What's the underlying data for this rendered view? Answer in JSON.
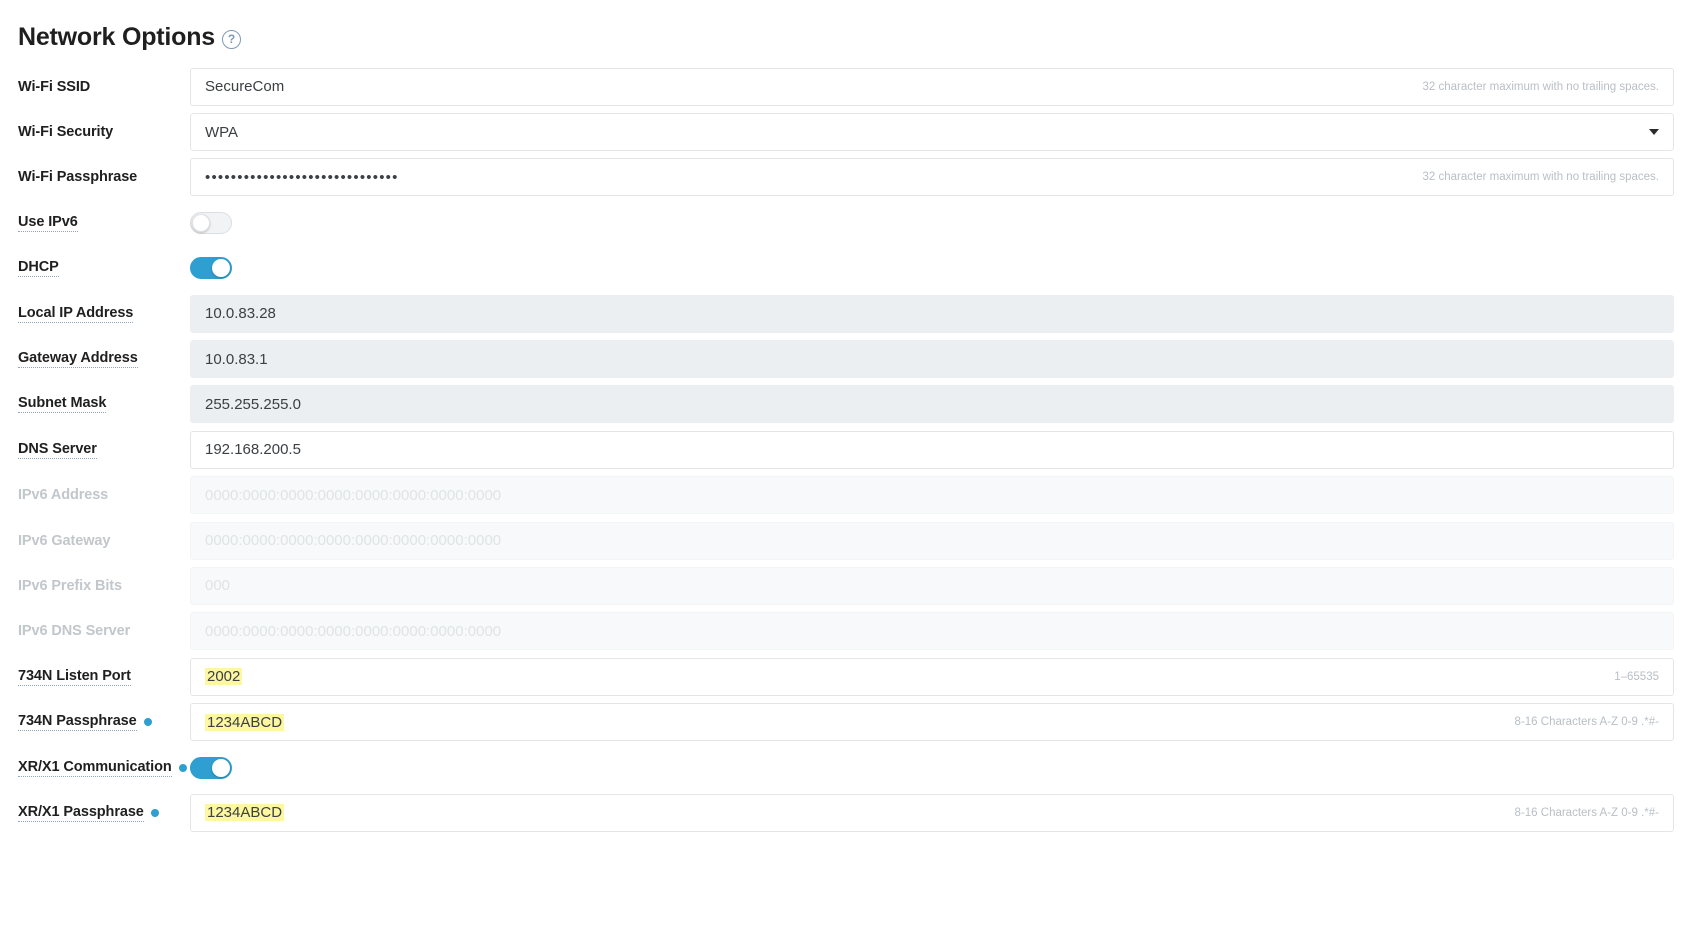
{
  "header": {
    "title": "Network Options",
    "help_icon": "help-circle-icon",
    "help_glyph": "?"
  },
  "hints": {
    "wifi_chars": "32 character maximum with no trailing spaces.",
    "port_range": "1–65535",
    "passphrase_rule": "8-16 Characters A-Z 0-9 .*#-"
  },
  "colors": {
    "toggle_on": "#2e9fd0",
    "dot": "#2e9fd0",
    "highlight": "#fcf7a0",
    "readonly_bg": "#eceff1"
  },
  "rows": [
    {
      "label": "Wi-Fi SSID",
      "type": "text",
      "value": "SecureCom",
      "hint": "32 character maximum with no trailing spaces.",
      "tooltip": false,
      "dot": false,
      "disabled": false,
      "readonly": false,
      "highlight": false
    },
    {
      "label": "Wi-Fi Security",
      "type": "select",
      "value": "WPA",
      "hint": "",
      "options": [
        "WPA"
      ],
      "tooltip": false,
      "dot": false,
      "disabled": false,
      "readonly": false,
      "highlight": false
    },
    {
      "label": "Wi-Fi Passphrase",
      "type": "password",
      "value": "••••••••••••••••••••••••••••••",
      "hint": "32 character maximum with no trailing spaces.",
      "tooltip": false,
      "dot": false,
      "disabled": false,
      "readonly": false,
      "highlight": false
    },
    {
      "label": "Use IPv6",
      "type": "toggle",
      "value": "off",
      "hint": "",
      "tooltip": true,
      "dot": false,
      "disabled": false,
      "readonly": false,
      "highlight": false
    },
    {
      "label": "DHCP",
      "type": "toggle",
      "value": "on",
      "hint": "",
      "tooltip": true,
      "dot": false,
      "disabled": false,
      "readonly": false,
      "highlight": false
    },
    {
      "label": "Local IP Address",
      "type": "text",
      "value": "10.0.83.28",
      "hint": "",
      "tooltip": true,
      "dot": false,
      "disabled": false,
      "readonly": true,
      "highlight": false
    },
    {
      "label": "Gateway Address",
      "type": "text",
      "value": "10.0.83.1",
      "hint": "",
      "tooltip": true,
      "dot": false,
      "disabled": false,
      "readonly": true,
      "highlight": false
    },
    {
      "label": "Subnet Mask",
      "type": "text",
      "value": "255.255.255.0",
      "hint": "",
      "tooltip": true,
      "dot": false,
      "disabled": false,
      "readonly": true,
      "highlight": false
    },
    {
      "label": "DNS Server",
      "type": "text",
      "value": "192.168.200.5",
      "hint": "",
      "tooltip": true,
      "dot": false,
      "disabled": false,
      "readonly": false,
      "highlight": false
    },
    {
      "label": "IPv6 Address",
      "type": "text",
      "value": "",
      "placeholder": "0000:0000:0000:0000:0000:0000:0000:0000",
      "hint": "",
      "tooltip": false,
      "dot": false,
      "disabled": true,
      "readonly": false,
      "highlight": false
    },
    {
      "label": "IPv6 Gateway",
      "type": "text",
      "value": "",
      "placeholder": "0000:0000:0000:0000:0000:0000:0000:0000",
      "hint": "",
      "tooltip": false,
      "dot": false,
      "disabled": true,
      "readonly": false,
      "highlight": false
    },
    {
      "label": "IPv6 Prefix Bits",
      "type": "text",
      "value": "",
      "placeholder": "000",
      "hint": "",
      "tooltip": false,
      "dot": false,
      "disabled": true,
      "readonly": false,
      "highlight": false
    },
    {
      "label": "IPv6 DNS Server",
      "type": "text",
      "value": "",
      "placeholder": "0000:0000:0000:0000:0000:0000:0000:0000",
      "hint": "",
      "tooltip": false,
      "dot": false,
      "disabled": true,
      "readonly": false,
      "highlight": false
    },
    {
      "label": "734N Listen Port",
      "type": "text",
      "value": "2002",
      "hint": "1–65535",
      "tooltip": true,
      "dot": false,
      "disabled": false,
      "readonly": false,
      "highlight": true
    },
    {
      "label": "734N Passphrase",
      "type": "text",
      "value": "1234ABCD",
      "hint": "8-16 Characters A-Z 0-9 .*#-",
      "tooltip": true,
      "dot": true,
      "disabled": false,
      "readonly": false,
      "highlight": true
    },
    {
      "label": "XR/X1 Communication",
      "type": "toggle",
      "value": "on",
      "hint": "",
      "tooltip": true,
      "dot": true,
      "disabled": false,
      "readonly": false,
      "highlight": false
    },
    {
      "label": "XR/X1 Passphrase",
      "type": "text",
      "value": "1234ABCD",
      "hint": "8-16 Characters A-Z 0-9 .*#-",
      "tooltip": true,
      "dot": true,
      "disabled": false,
      "readonly": false,
      "highlight": true
    }
  ]
}
